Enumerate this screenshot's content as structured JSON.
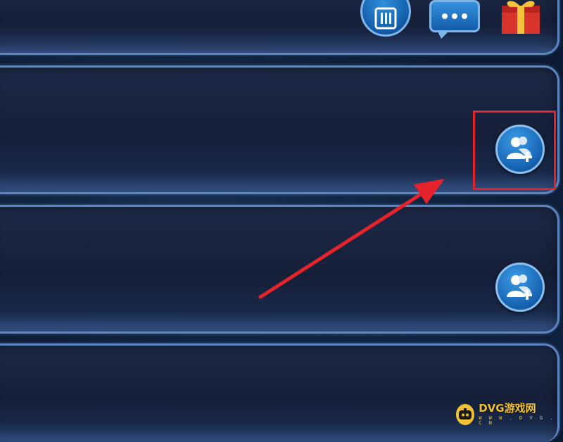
{
  "toolbar": {
    "icons": [
      "list-icon",
      "chat-icon",
      "gift-icon"
    ]
  },
  "rows": [
    {
      "action_icon": "add-friend-icon",
      "highlighted": true
    },
    {
      "action_icon": "add-friend-icon",
      "highlighted": false
    },
    {
      "action_icon": null,
      "highlighted": false
    }
  ],
  "annotation": {
    "box_color": "#e5232a",
    "arrow_color": "#e5232a"
  },
  "watermark": {
    "title": "DVG游戏网",
    "url": "W W W . D V G . C N"
  },
  "colors": {
    "panel_border": "#5a86c4",
    "button_blue": "#1561b0",
    "accent_yellow": "#f1c232"
  }
}
